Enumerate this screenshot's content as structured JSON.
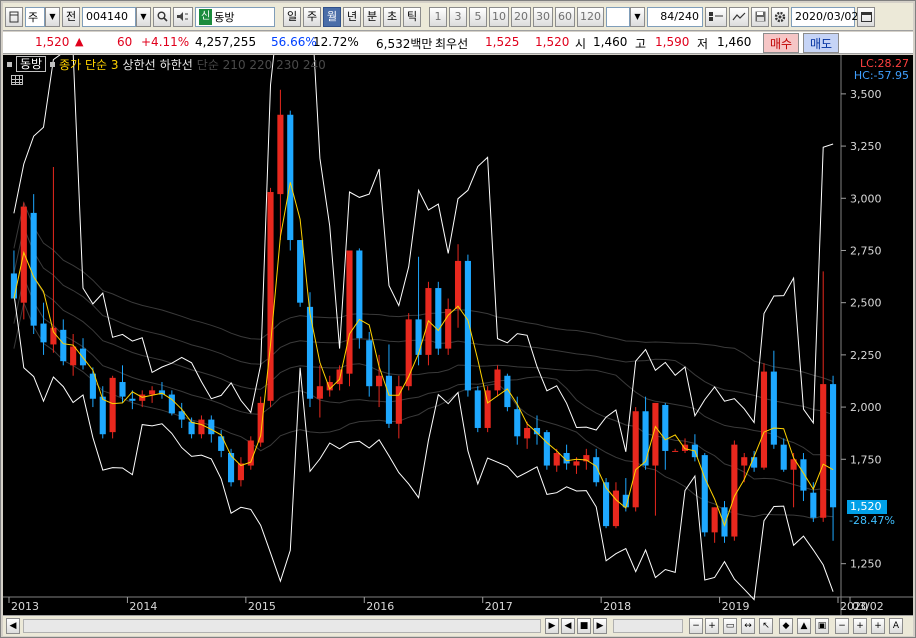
{
  "toolbar": {
    "market": "주",
    "prev_label": "전",
    "code": "004140",
    "tag": "신",
    "name": "동방",
    "periods": [
      "일",
      "주",
      "월",
      "년",
      "분",
      "초",
      "틱"
    ],
    "active_period": "월",
    "counts": [
      "1",
      "3",
      "5",
      "10",
      "20",
      "30",
      "60",
      "120"
    ],
    "view_count": "84",
    "total_count": "/240",
    "date": "2020/03/02"
  },
  "quote": {
    "price": "1,520",
    "arrow": "▲",
    "change": "60",
    "change_pct": "+4.11%",
    "volume": "4,257,255",
    "vol_ratio": "56.66%",
    "turnover": "12.72%",
    "amount": "6,532백만",
    "best_ask_label": "최우선",
    "best_ask": "1,525",
    "best_bid": "1,520",
    "open_label": "시",
    "open": "1,460",
    "high_label": "고",
    "high": "1,590",
    "low_label": "저",
    "low": "1,460",
    "buy_label": "매수",
    "sell_label": "매도"
  },
  "legend": {
    "name": "동방",
    "ma": "종가 단순 3",
    "upper": "상한선",
    "lower": "하한선",
    "dim": "단순 210 220 230 240"
  },
  "indicators": {
    "lc": "LC:28.27",
    "hc": "HC:-57.95"
  },
  "colors": {
    "up": "#e8281e",
    "down": "#1ea8ff",
    "ma": "#ffd200",
    "band": "#ffffff",
    "bg": "#000000"
  },
  "chart_data": {
    "type": "candlestick",
    "title": "동방",
    "ylim": [
      1100,
      3600
    ],
    "yticks": [
      "3,500",
      "3,250",
      "3,000",
      "2,750",
      "2,500",
      "2,250",
      "2,000",
      "1,750",
      "1,250"
    ],
    "ytick_values": [
      3500,
      3250,
      3000,
      2750,
      2500,
      2250,
      2000,
      1750,
      1250
    ],
    "xticks": [
      "2013",
      "2014",
      "2015",
      "2016",
      "2017",
      "2018",
      "2019",
      "2020",
      "03/02"
    ],
    "last_price": "1,520",
    "last_pct": "-28.47%",
    "candles": [
      [
        2640,
        2750,
        2560,
        2520
      ],
      [
        2500,
        2980,
        2420,
        2960
      ],
      [
        2930,
        3020,
        2350,
        2390
      ],
      [
        2400,
        2500,
        2250,
        2310
      ],
      [
        2300,
        3150,
        2260,
        2380
      ],
      [
        2370,
        2420,
        2200,
        2220
      ],
      [
        2200,
        2350,
        2150,
        2290
      ],
      [
        2280,
        2330,
        2180,
        2200
      ],
      [
        2160,
        2190,
        2000,
        2040
      ],
      [
        2050,
        2100,
        1850,
        1870
      ],
      [
        1880,
        2150,
        1850,
        2140
      ],
      [
        2120,
        2200,
        2020,
        2050
      ],
      [
        2040,
        2080,
        1990,
        2030
      ],
      [
        2030,
        2080,
        2000,
        2060
      ],
      [
        2060,
        2100,
        2020,
        2080
      ],
      [
        2080,
        2120,
        2040,
        2060
      ],
      [
        2060,
        2080,
        1960,
        1970
      ],
      [
        1980,
        2020,
        1900,
        1940
      ],
      [
        1930,
        1950,
        1850,
        1870
      ],
      [
        1870,
        1960,
        1850,
        1940
      ],
      [
        1940,
        1960,
        1830,
        1870
      ],
      [
        1860,
        1890,
        1760,
        1790
      ],
      [
        1780,
        1800,
        1620,
        1640
      ],
      [
        1650,
        1760,
        1620,
        1730
      ],
      [
        1720,
        1860,
        1700,
        1840
      ],
      [
        1830,
        2050,
        1810,
        2020
      ],
      [
        2030,
        3050,
        2000,
        3030
      ],
      [
        3020,
        3520,
        2800,
        3400
      ],
      [
        3400,
        3420,
        2750,
        2800
      ],
      [
        2800,
        2800,
        2480,
        2500
      ],
      [
        2480,
        2550,
        2000,
        2040
      ],
      [
        2040,
        2200,
        1950,
        2100
      ],
      [
        2080,
        2150,
        2050,
        2120
      ],
      [
        2110,
        2200,
        2080,
        2180
      ],
      [
        2160,
        2750,
        2100,
        2750
      ],
      [
        2750,
        2760,
        2280,
        2330
      ],
      [
        2320,
        2360,
        2050,
        2100
      ],
      [
        2100,
        2250,
        2000,
        2150
      ],
      [
        2150,
        2300,
        1900,
        1920
      ],
      [
        1920,
        2150,
        1850,
        2100
      ],
      [
        2100,
        2450,
        2080,
        2420
      ],
      [
        2420,
        2720,
        2200,
        2250
      ],
      [
        2250,
        2600,
        2200,
        2570
      ],
      [
        2570,
        2600,
        2250,
        2280
      ],
      [
        2280,
        2520,
        2250,
        2470
      ],
      [
        2470,
        2780,
        2380,
        2700
      ],
      [
        2700,
        2730,
        2050,
        2080
      ],
      [
        2080,
        2100,
        1880,
        1900
      ],
      [
        1900,
        2100,
        1880,
        2080
      ],
      [
        2080,
        2200,
        2050,
        2180
      ],
      [
        2150,
        2160,
        1980,
        2000
      ],
      [
        1990,
        2050,
        1820,
        1860
      ],
      [
        1850,
        1930,
        1800,
        1900
      ],
      [
        1900,
        1960,
        1820,
        1870
      ],
      [
        1880,
        1890,
        1700,
        1720
      ],
      [
        1720,
        1800,
        1690,
        1780
      ],
      [
        1780,
        1820,
        1700,
        1730
      ],
      [
        1720,
        1760,
        1680,
        1740
      ],
      [
        1740,
        1800,
        1700,
        1770
      ],
      [
        1760,
        1800,
        1620,
        1640
      ],
      [
        1640,
        1660,
        1420,
        1430
      ],
      [
        1430,
        1640,
        1420,
        1600
      ],
      [
        1580,
        1660,
        1500,
        1520
      ],
      [
        1520,
        2000,
        1500,
        1980
      ],
      [
        1980,
        2050,
        1700,
        1720
      ],
      [
        1720,
        2010,
        1480,
        2020
      ],
      [
        2010,
        2020,
        1700,
        1790
      ],
      [
        1790,
        1800,
        1790,
        1790
      ],
      [
        1790,
        1850,
        1780,
        1820
      ],
      [
        1820,
        1870,
        1740,
        1760
      ],
      [
        1770,
        1780,
        1380,
        1400
      ],
      [
        1400,
        1520,
        1350,
        1520
      ],
      [
        1520,
        1550,
        1350,
        1380
      ],
      [
        1380,
        1840,
        1360,
        1820
      ],
      [
        1720,
        1780,
        1640,
        1760
      ],
      [
        1760,
        1790,
        1690,
        1710
      ],
      [
        1710,
        2210,
        1700,
        2170
      ],
      [
        2170,
        2270,
        1800,
        1820
      ],
      [
        1820,
        1850,
        1690,
        1700
      ],
      [
        1700,
        1780,
        1520,
        1750
      ],
      [
        1750,
        1780,
        1550,
        1600
      ],
      [
        1590,
        1640,
        1450,
        1470
      ],
      [
        1470,
        2650,
        1450,
        2110
      ],
      [
        2110,
        2150,
        1360,
        1520
      ]
    ]
  }
}
